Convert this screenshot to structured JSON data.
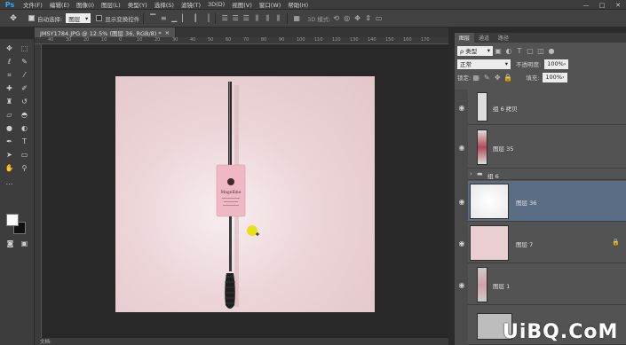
{
  "app": {
    "logo": "Ps",
    "menu": [
      "文件(F)",
      "编辑(E)",
      "图像(I)",
      "图层(L)",
      "类型(Y)",
      "选择(S)",
      "滤镜(T)",
      "3D(D)",
      "视图(V)",
      "窗口(W)",
      "帮助(H)"
    ]
  },
  "options": {
    "auto_select_label": "自动选择:",
    "auto_select_value": "图层",
    "show_transform_label": "显示变换控件",
    "mode_3d_label": "3D 模式:"
  },
  "document": {
    "tab_title": "JMSY1784.JPG @ 12.5% (图层 36, RGB/8) *",
    "close": "×",
    "status": "文档:"
  },
  "ruler": {
    "top": [
      "40",
      "30",
      "20",
      "10",
      "0",
      "10",
      "20",
      "30",
      "40",
      "50",
      "60",
      "70",
      "80",
      "90",
      "100",
      "110",
      "120",
      "130",
      "140",
      "150",
      "160",
      "170",
      "180",
      "190"
    ]
  },
  "canvas": {
    "product_brand": "Magelline",
    "background_color": "#e9cfd2",
    "tube_color": "#f0b8c4"
  },
  "panel": {
    "tabs": [
      "图层",
      "通道",
      "路径"
    ],
    "filter_label": "ρ 类型",
    "blend_mode": "正常",
    "opacity_label": "不透明度:",
    "opacity_value": "100%",
    "lock_label": "锁定:",
    "fill_label": "填充:",
    "fill_value": "100%",
    "layers": [
      {
        "name": "组 6 拷贝",
        "selected": false
      },
      {
        "name": "图层 35",
        "selected": false
      },
      {
        "name": "组 6",
        "selected": false
      },
      {
        "name": "图层 36",
        "selected": true
      },
      {
        "name": "图层 7",
        "selected": false
      },
      {
        "name": "图层 1",
        "selected": false
      }
    ]
  },
  "watermark": "UiBQ.CoM"
}
